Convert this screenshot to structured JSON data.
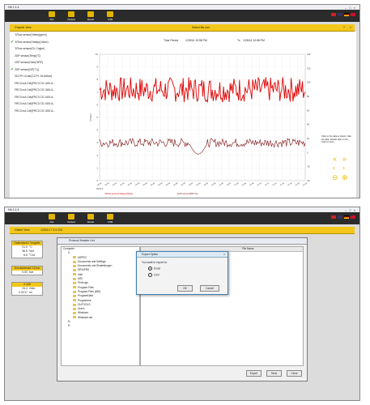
{
  "toolbar": {
    "app_title": "HA  1.1.4",
    "buttons": [
      "File",
      "Default",
      "Model",
      "USB"
    ],
    "flag_colors": [
      "#cc2222",
      "#333366",
      "#ffcc00",
      "#c8102e"
    ]
  },
  "graph_view": {
    "title": "Graphic View",
    "center_title": "Select fits.csd",
    "time_label": "Time Period",
    "time_from": "1/25/14 10:58 PM",
    "time_to_label": "To",
    "time_to": "1/25/14 10:58 PM",
    "sensors": [
      {
        "label": "'1Flow sensor(Yalex)(gm/s)",
        "checked": false
      },
      {
        "label": "'1Flow sensor(Yaiejo)(Yaiex)",
        "checked": true
      },
      {
        "label": "'1Flow sensor(Gl, Cnglzr)",
        "checked": false
      },
      {
        "label": "2GP sensor(Temp(°C)",
        "checked": false
      },
      {
        "label": "2GP sensor(Hum(%RF)",
        "checked": false
      },
      {
        "label": "2GP sensor(DP(°C))",
        "checked": true
      },
      {
        "label": "3C3 Pt 10 bar(C3 Pt. 16 Arrbar)",
        "checked": false
      },
      {
        "label": "FRC3 mA Cell(FRC3 CS 1000 A...",
        "checked": false
      },
      {
        "label": "FRC3 mA Cell(FRC3 CS 1000 A...",
        "checked": false
      },
      {
        "label": "FRC3 mA Cell(FRC3 CS 1000 A...",
        "checked": false
      },
      {
        "label": "FRC3 mA Cell(FRC3 CS 1000 A...",
        "checked": false
      },
      {
        "label": "FRC3 mA Cell(FRC3 CS 1000 A...",
        "checked": false
      }
    ],
    "note": "Click on the data to check / hide the data. Double click on the chart to zoom",
    "colors": {
      "series_a": "#e00000",
      "series_b": "#7a1010",
      "accent": "#f2c71a"
    }
  },
  "chart_data": {
    "type": "line",
    "ylabel_left": "m³/min",
    "ylim_left": [
      0,
      10
    ],
    "ylim_right": [
      -40,
      140
    ],
    "left_ticks": [
      "10",
      "9",
      "8",
      "7",
      "6",
      "5",
      "4",
      "3",
      "2",
      "1",
      "0"
    ],
    "right_ticks": [
      "140",
      "120",
      "100",
      "80",
      "60",
      "40",
      "20",
      "0",
      "-20",
      "-40"
    ],
    "x_ticks": [
      "10:28",
      "10:30",
      "10:32",
      "10:34",
      "10:36",
      "10:38",
      "10:40",
      "10:42",
      "10:44",
      "10:46",
      "10:48",
      "10:50",
      "10:52",
      "10:54",
      "10:56",
      "10:58",
      "11:00",
      "11:02",
      "11:04",
      "11:06",
      "11:08",
      "11:10",
      "11:12",
      "11:14",
      "11:16",
      "11:18",
      "11:20",
      "11:22"
    ],
    "x_first_caption": "03.01.3",
    "legend": [
      "'1Flow sensor(Yaiejo)(Yaiex)",
      "2GP sensor(DP(°C))"
    ],
    "series": [
      {
        "name": "'1Flow sensor(Yaiejo)(Yaiex)",
        "color": "#e00000",
        "mean": 7.2,
        "band": 1.0,
        "n": 220
      },
      {
        "name": "2GP sensor(DP(°C))",
        "color": "#7a1010",
        "mean": 3.0,
        "band": 0.35,
        "n": 220
      }
    ]
  },
  "online_view": {
    "title": "Online View",
    "date": "1/25/14 7:1/1 000",
    "box1": {
      "title": "Datenstand / Vorgabe",
      "rows": [
        {
          "v": "21.0",
          "u": "°C"
        },
        {
          "v": "36.6",
          "u": "%rh"
        },
        {
          "v": "6.5",
          "u": "°Cld"
        }
      ]
    },
    "box2": {
      "title": "Druckadresse/ 16 bar",
      "rows": [
        {
          "v": "0.00",
          "u": "bar"
        }
      ]
    },
    "box3": {
      "title": "0.418",
      "rows": [
        {
          "v": "24.4",
          "u": "l/min"
        },
        {
          "v": "0.0217",
          "u": "m³"
        }
      ]
    },
    "protocol_title": "Protocol Header List",
    "tree": [
      {
        "label": "Computer",
        "indent": 0,
        "folder": false
      },
      {
        "label": "C:",
        "indent": 1,
        "folder": false
      },
      {
        "label": "ASPEG",
        "indent": 2,
        "folder": true
      },
      {
        "label": "Documents and Settings",
        "indent": 2,
        "folder": true
      },
      {
        "label": "Documents und Einstellungen",
        "indent": 2,
        "folder": true
      },
      {
        "label": "DRIVERS",
        "indent": 2,
        "folder": true
      },
      {
        "label": "Intel",
        "indent": 2,
        "folder": true
      },
      {
        "label": "MSI",
        "indent": 2,
        "folder": true
      },
      {
        "label": "PerfLogs",
        "indent": 2,
        "folder": true
      },
      {
        "label": "Program Files",
        "indent": 2,
        "folder": true
      },
      {
        "label": "Program Files (x86)",
        "indent": 2,
        "folder": true
      },
      {
        "label": "ProgramData",
        "indent": 2,
        "folder": true
      },
      {
        "label": "Programme",
        "indent": 2,
        "folder": true
      },
      {
        "label": "OUTOOLS",
        "indent": 2,
        "folder": true
      },
      {
        "label": "Users",
        "indent": 2,
        "folder": true
      },
      {
        "label": "Windows",
        "indent": 2,
        "folder": true
      },
      {
        "label": "Windows.old",
        "indent": 2,
        "folder": true
      },
      {
        "label": "D:",
        "indent": 1,
        "folder": false
      },
      {
        "label": "E:",
        "indent": 1,
        "folder": false
      }
    ],
    "grid_header": "File Name",
    "buttons": {
      "export": "Export",
      "send": "Send",
      "close": "Close"
    },
    "dialog": {
      "title": "Export Option",
      "question": "You want to export to:",
      "opt1": "Excel",
      "opt2": "CSV",
      "ok": "OK",
      "cancel": "Cancel"
    }
  }
}
